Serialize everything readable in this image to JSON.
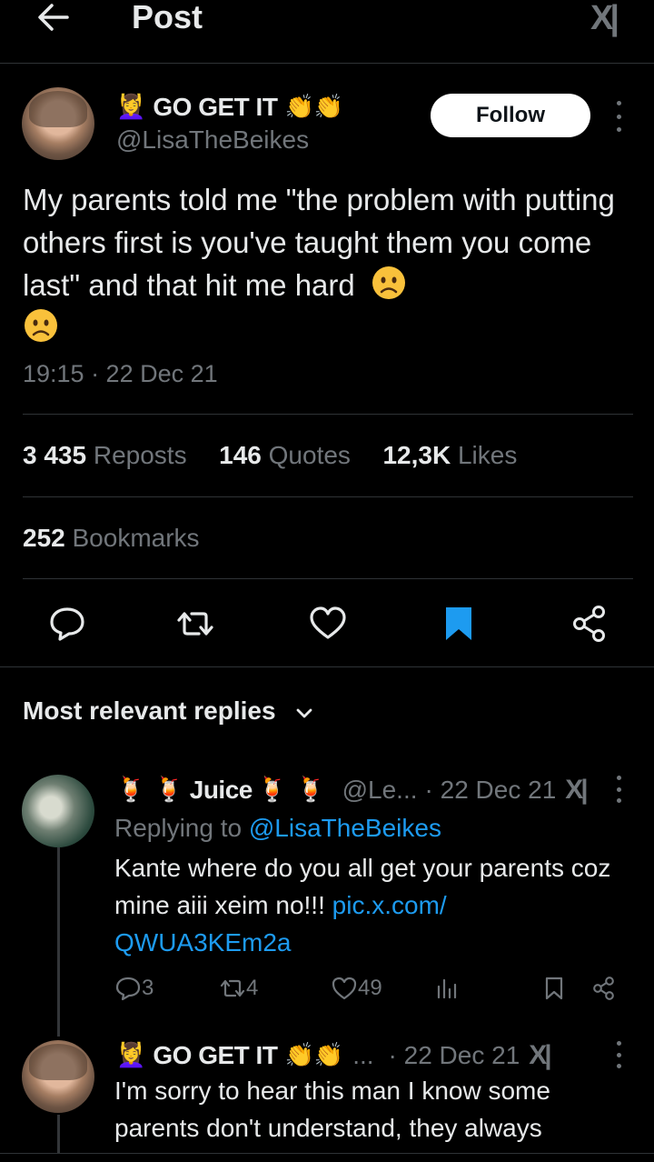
{
  "header": {
    "title": "Post",
    "logo": "X"
  },
  "post": {
    "author_name": "GO GET IT",
    "author_emoji_prefix": "💆‍♀️",
    "author_emoji_suffix": "👏👏",
    "handle": "@LisaTheBeikes",
    "follow_label": "Follow",
    "text": "My parents told me \"the problem with putting others first is you've taught them you come last\" and that hit me hard",
    "timestamp": "19:15 · 22 Dec 21",
    "reposts_count": "3 435",
    "reposts_label": "Reposts",
    "quotes_count": "146",
    "quotes_label": "Quotes",
    "likes_count": "12,3K",
    "likes_label": "Likes",
    "bookmarks_count": "252",
    "bookmarks_label": "Bookmarks"
  },
  "replies_section": {
    "title": "Most relevant replies"
  },
  "reply1": {
    "name": "Juice",
    "emoji": "🍹",
    "handle": "@Le...",
    "date": "· 22 Dec 21",
    "replying_prefix": "Replying to",
    "replying_handle": "@LisaTheBeikes",
    "text": "Kante where do you all get your parents coz mine aiii xeim no!!!",
    "link_part1": "pic.x.com/",
    "link_part2": "QWUA3KEm2a",
    "comments": "3",
    "reposts": "4",
    "likes": "49"
  },
  "reply2": {
    "name": "GO GET IT",
    "ellipsis": "...",
    "date": "· 22 Dec 21",
    "text_line1": "I'm sorry to hear this man I know some",
    "text_line2": "parents don't understand, they always"
  },
  "colors": {
    "accent": "#1d9bf0",
    "muted": "#71767b",
    "text": "#e7e9ea",
    "divider": "#2f3336"
  }
}
